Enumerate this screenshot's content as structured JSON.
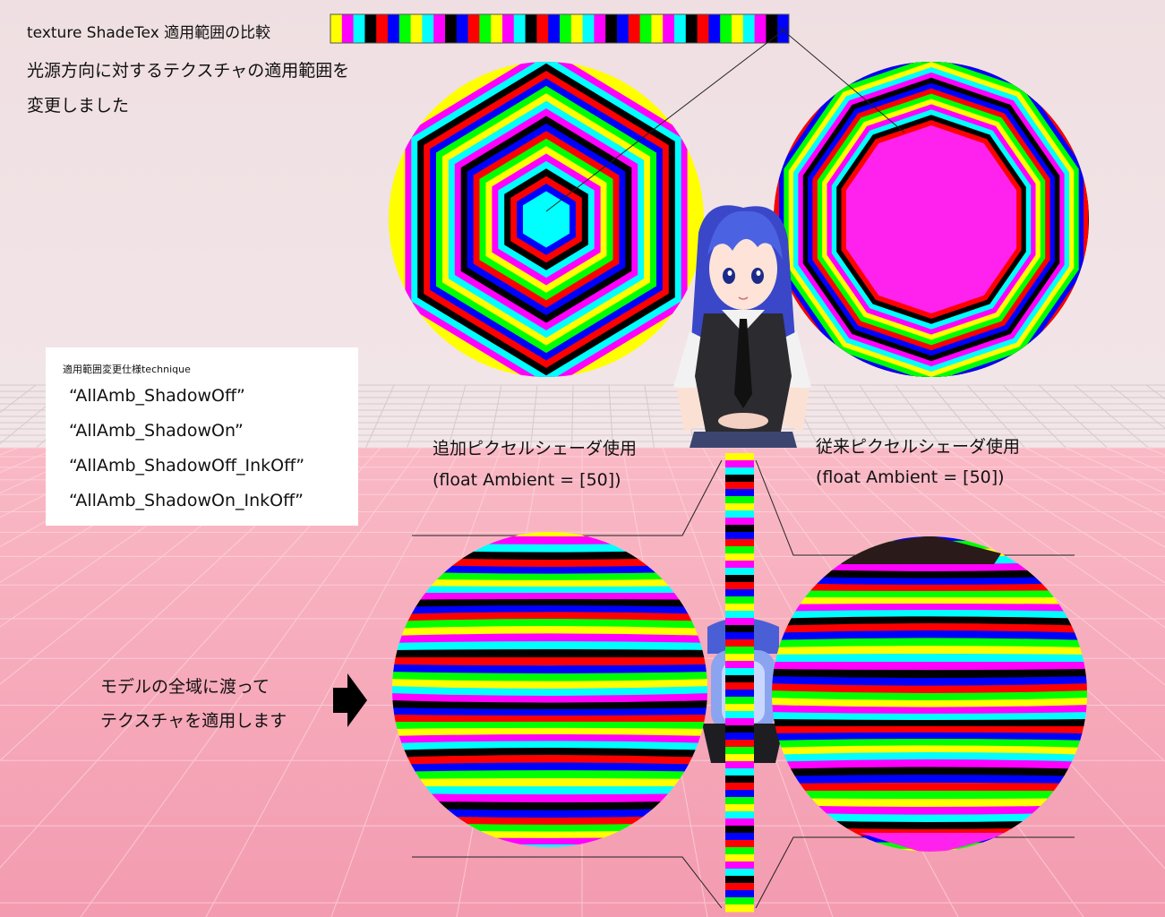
{
  "title": "texture ShadeTex 適用範囲の比較",
  "description": [
    "光源方向に対するテクスチャの適用範囲を",
    "変更しました"
  ],
  "panel": {
    "heading": "適用範囲変更仕様technique",
    "techniques": [
      "“AllAmb_ShadowOff”",
      "“AllAmb_ShadowOn”",
      "“AllAmb_ShadowOff_InkOff”",
      "“AllAmb_ShadowOn_InkOff”"
    ]
  },
  "labels": {
    "added_shader": [
      "追加ピクセルシェーダ使用",
      "(float Ambient = [50])"
    ],
    "legacy_shader": [
      "従来ピクセルシェーダ使用",
      "(float Ambient = [50])"
    ]
  },
  "note": [
    "モデルの全域に渡って",
    "テクスチャを適用します"
  ],
  "texture_colors": [
    "#ffff00",
    "#ff00ff",
    "#00ffff",
    "#000000",
    "#ff0000",
    "#0000ff",
    "#00ff00",
    "#ffff00",
    "#00ffff",
    "#ff00ff",
    "#000000",
    "#0000ff",
    "#ff0000",
    "#00ff00"
  ],
  "colors": {
    "wall": "#efe0e2",
    "floor": "#f4a9b6",
    "sphere_center_left": "#00ffff",
    "sphere_center_right": "#ff22ee"
  },
  "icons": {
    "arrow": "right-arrow-icon",
    "character": "character-figure"
  }
}
